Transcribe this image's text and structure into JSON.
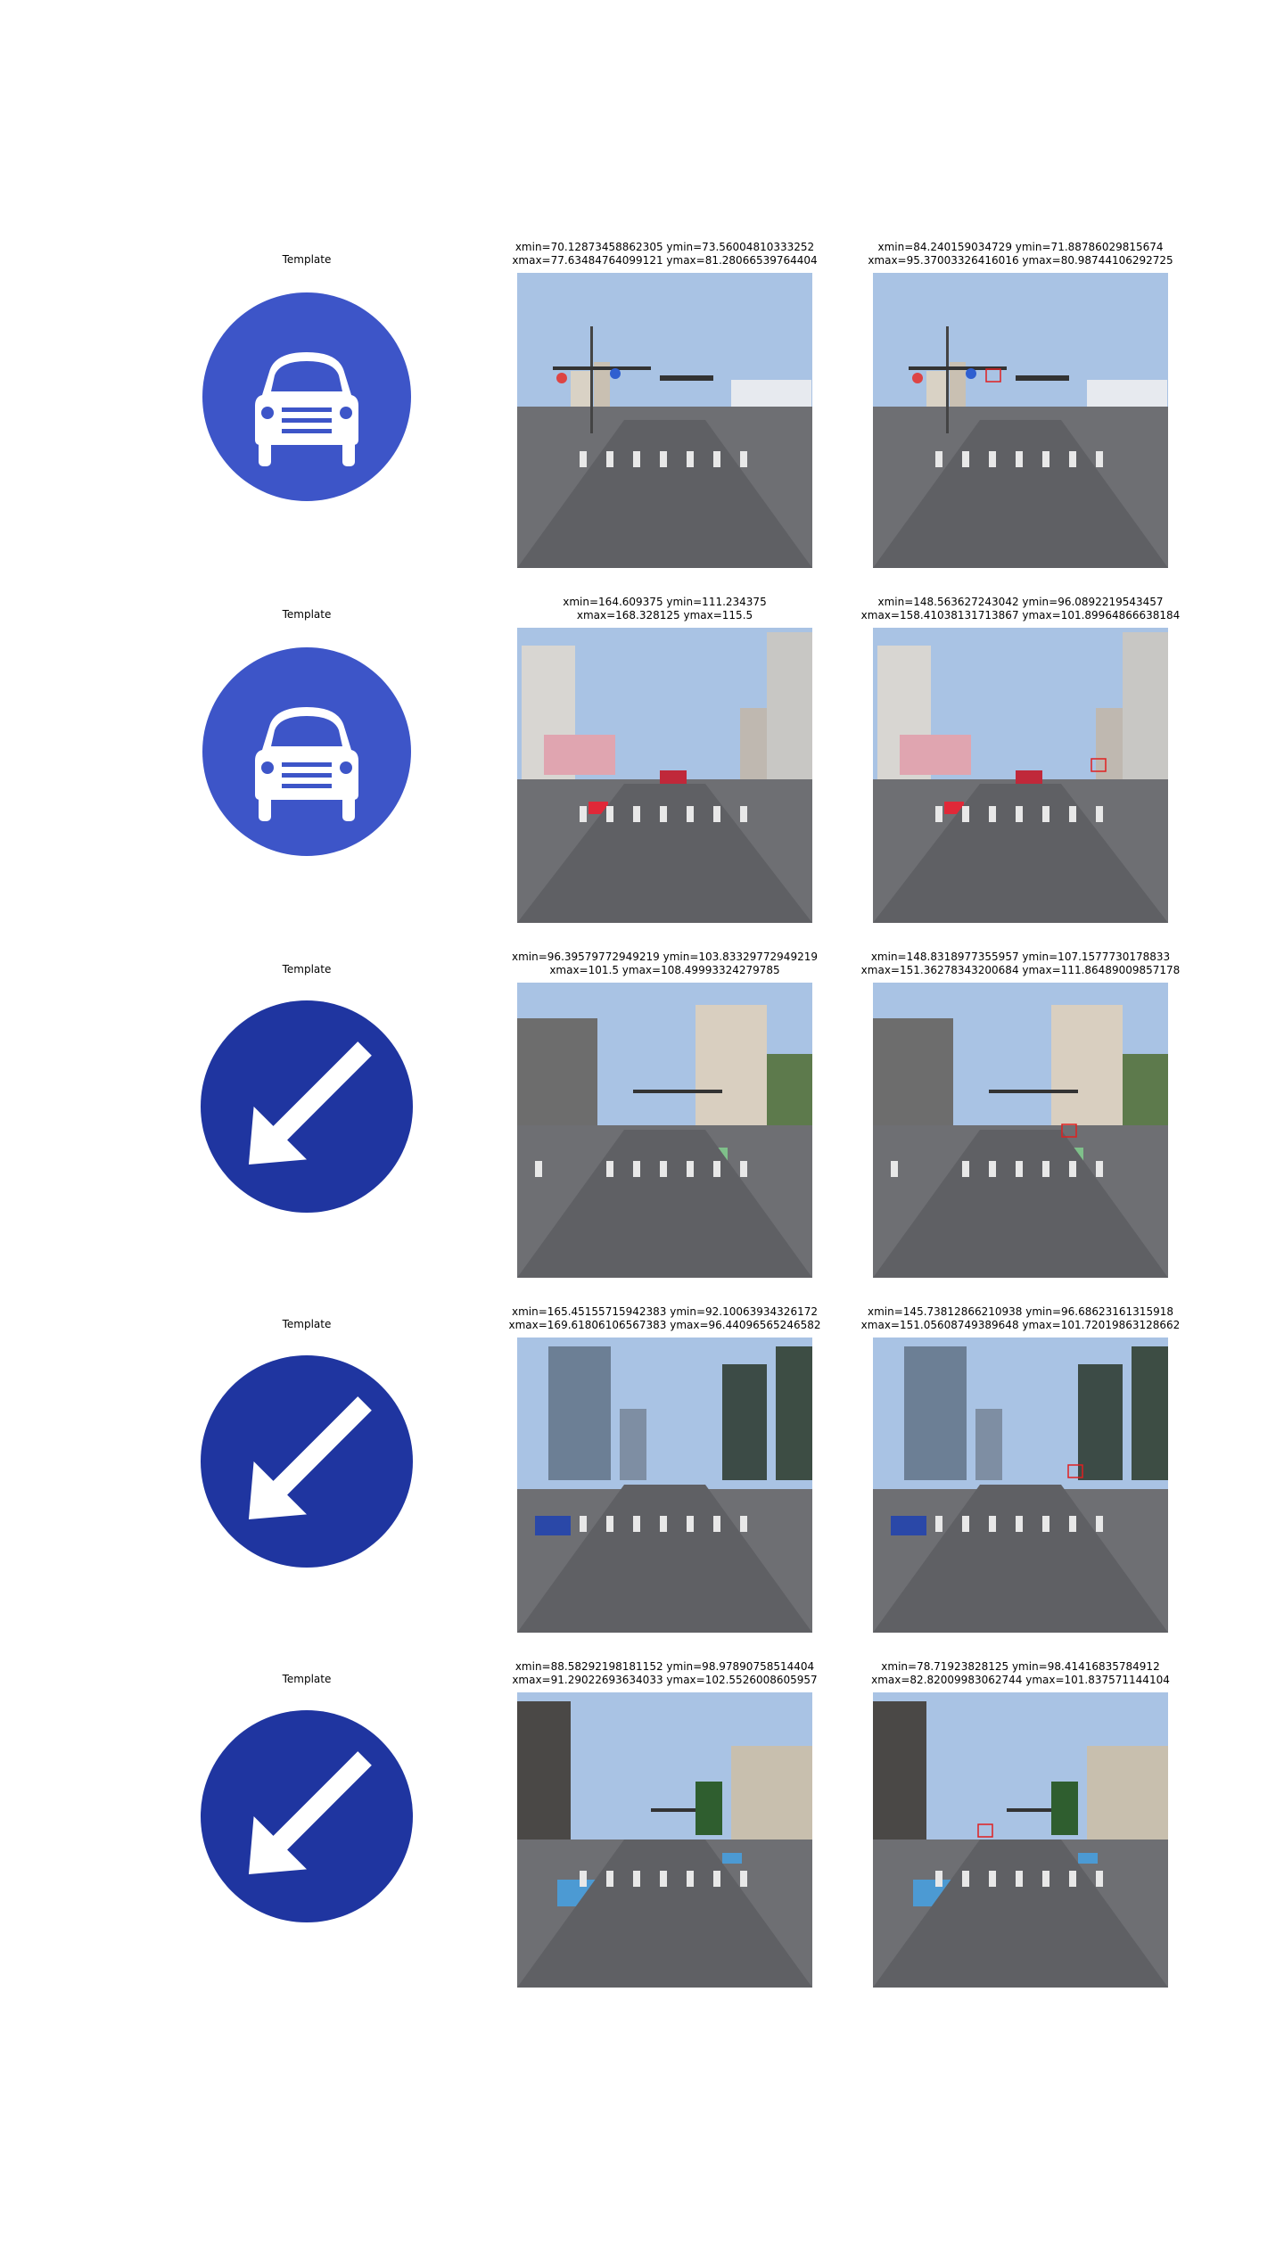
{
  "rows": [
    {
      "template_label": "Template",
      "sign": "car-sign",
      "pred_line1": "xmin=70.12873458862305 ymin=73.56004810333252",
      "pred_line2": "xmax=77.63484764099121 ymax=81.28066539764404",
      "gt_line1": "xmin=84.240159034729 ymin=71.88786029815674",
      "gt_line2": "xmax=95.37003326416016 ymax=80.98744106292725"
    },
    {
      "template_label": "Template",
      "sign": "car-sign",
      "pred_line1": "xmin=164.609375 ymin=111.234375",
      "pred_line2": "xmax=168.328125 ymax=115.5",
      "gt_line1": "xmin=148.563627243042 ymin=96.0892219543457",
      "gt_line2": "xmax=158.41038131713867 ymax=101.89964866638184"
    },
    {
      "template_label": "Template",
      "sign": "keep-right-arrow-sign",
      "pred_line1": "xmin=96.39579772949219 ymin=103.83329772949219",
      "pred_line2": "xmax=101.5 ymax=108.49993324279785",
      "gt_line1": "xmin=148.8318977355957 ymin=107.1577730178833",
      "gt_line2": "xmax=151.36278343200684 ymax=111.86489009857178"
    },
    {
      "template_label": "Template",
      "sign": "keep-right-arrow-sign",
      "pred_line1": "xmin=165.45155715942383 ymin=92.10063934326172",
      "pred_line2": "xmax=169.61806106567383 ymax=96.44096565246582",
      "gt_line1": "xmin=145.73812866210938 ymin=96.68623161315918",
      "gt_line2": "xmax=151.05608749389648 ymax=101.72019863128662"
    },
    {
      "template_label": "Template",
      "sign": "keep-right-arrow-sign",
      "pred_line1": "xmin=88.58292198181152 ymin=98.97890758514404",
      "pred_line2": "xmax=91.29022693634033 ymax=102.5526008605957",
      "gt_line1": "xmin=78.71923828125 ymin=98.41416835784912",
      "gt_line2": "xmax=82.82009983062744 ymax=101.837571144104"
    }
  ],
  "colors": {
    "car_sign_blue": "#3d55c8",
    "arrow_sign_blue": "#1f35a0",
    "sky": "#a9c3e4",
    "road": "#6e6f73"
  }
}
